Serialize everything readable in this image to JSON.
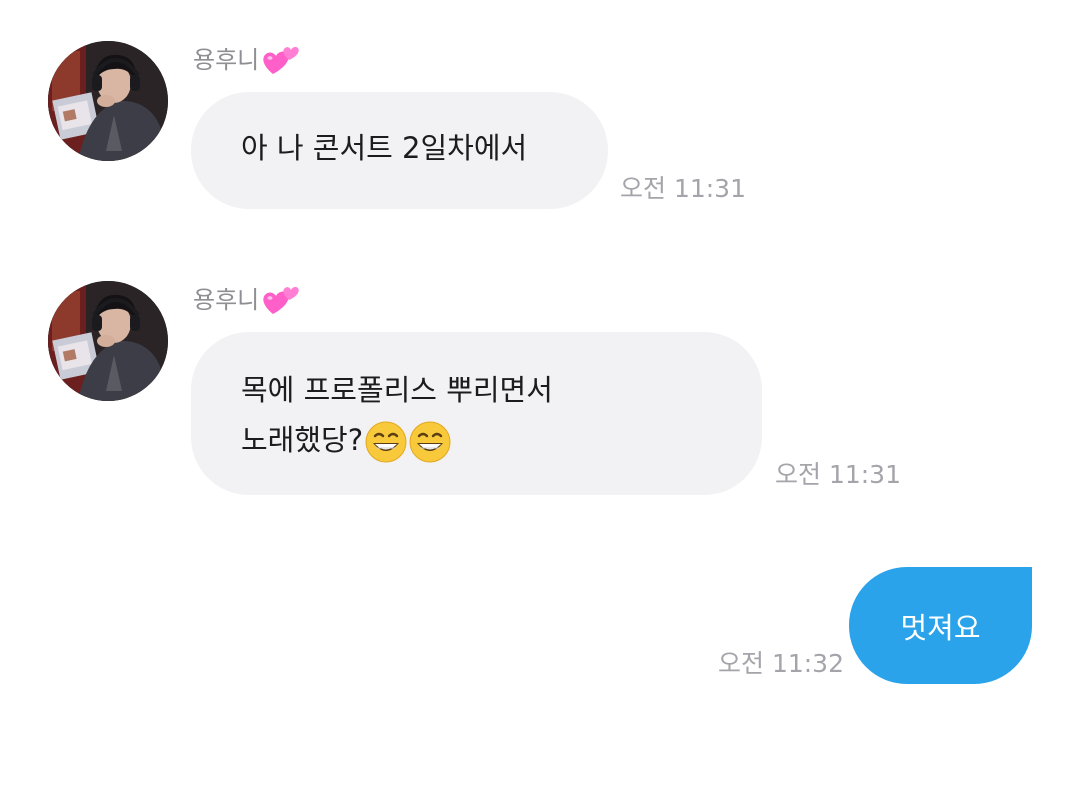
{
  "messages": [
    {
      "sender": "용후니",
      "sender_emoji": "two-hearts-icon",
      "lines": [
        "아 나 콘서트 2일차에서"
      ],
      "time": "오전 11:31",
      "direction": "incoming"
    },
    {
      "sender": "용후니",
      "sender_emoji": "two-hearts-icon",
      "lines": [
        "목에 프로폴리스 뿌리면서",
        "노래했당?"
      ],
      "trailing_emojis": [
        "grinning-face-icon",
        "grinning-face-icon"
      ],
      "time": "오전 11:31",
      "direction": "incoming"
    },
    {
      "text": "멋져요",
      "time": "오전 11:32",
      "direction": "outgoing"
    }
  ],
  "colors": {
    "incoming_bubble": "#f2f2f4",
    "outgoing_bubble": "#2aa3ea",
    "timestamp": "#a4a4aa",
    "sender_name": "#8e8e93"
  }
}
